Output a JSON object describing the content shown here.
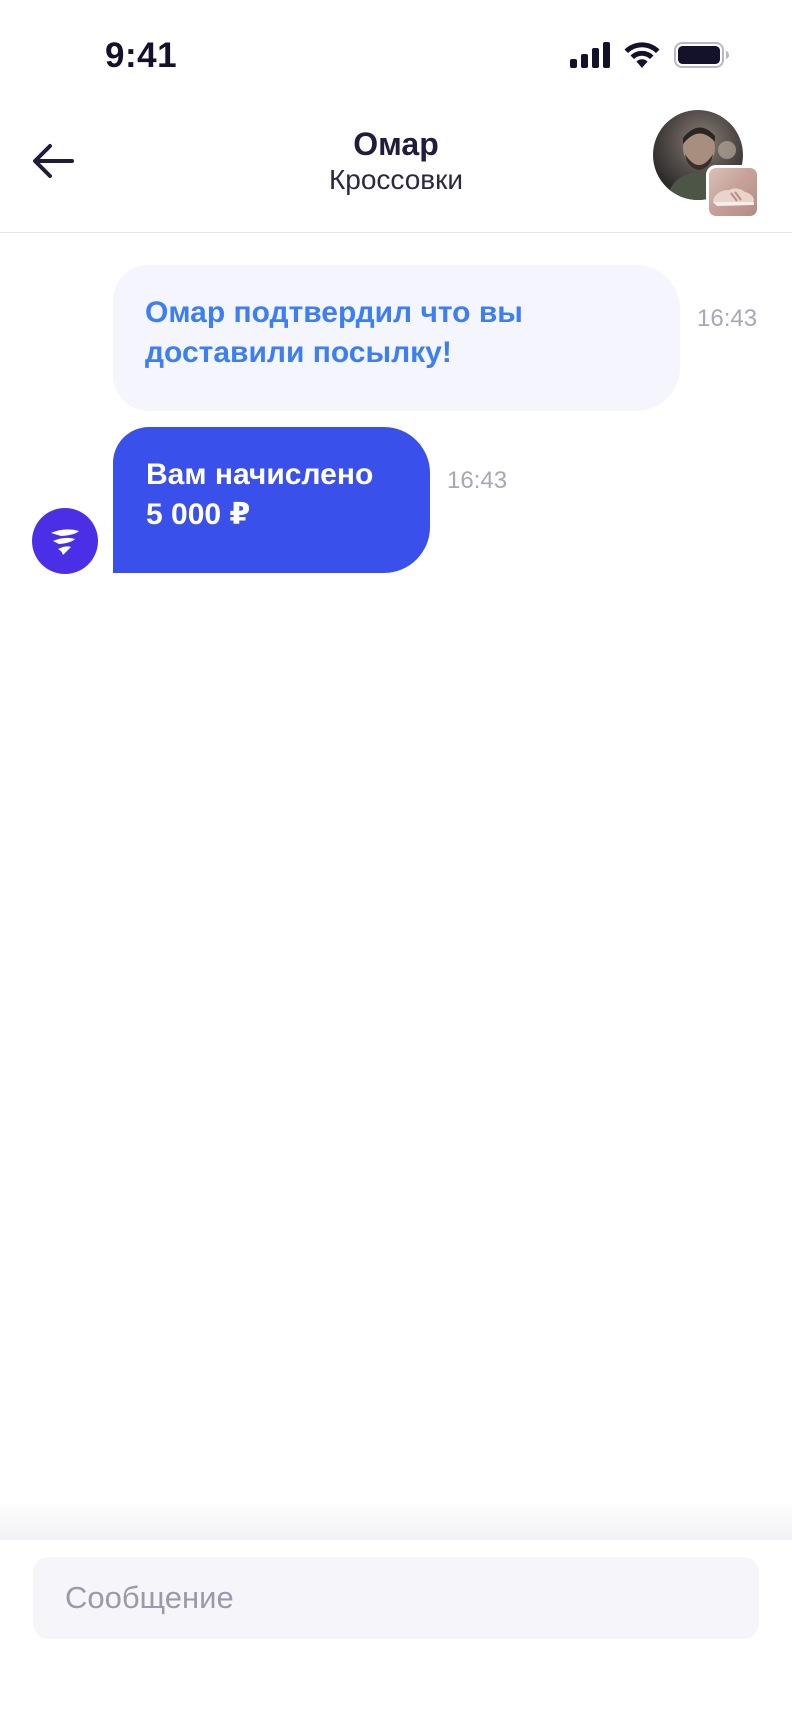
{
  "status_bar": {
    "time": "9:41"
  },
  "header": {
    "title": "Омар",
    "subtitle": "Кроссовки"
  },
  "messages": [
    {
      "text_line1": "Омар подтвердил что вы",
      "text_line2": "доставили посылку!",
      "time": "16:43",
      "style": "system-light"
    },
    {
      "text_line1": "Вам начислено",
      "text_line2": "5 000 ₽",
      "time": "16:43",
      "style": "accent"
    }
  ],
  "input": {
    "placeholder": "Сообщение"
  },
  "colors": {
    "accent_blue": "#3a50ea",
    "link_blue": "#3d7ff0",
    "bot_purple": "#4b2fe6",
    "bubble_light": "#f4f5fd",
    "muted_time": "#a8a7b5"
  },
  "icons": [
    "back-arrow-icon",
    "signal-icon",
    "wifi-icon",
    "battery-icon",
    "bot-logo-icon"
  ]
}
